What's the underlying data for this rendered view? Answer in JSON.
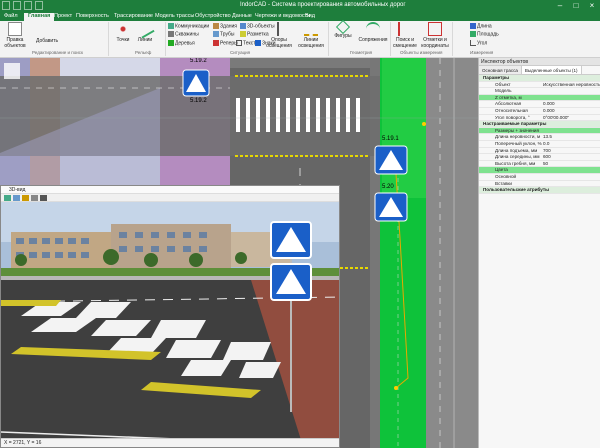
{
  "app": {
    "title": "IndorCAD - Система проектирования автомобильных дорог",
    "accent_color": "#1e7e3c",
    "window_controls": [
      "minimize-icon",
      "maximize-icon",
      "close-icon"
    ]
  },
  "menu": {
    "tabs": [
      "Файл",
      "Главная",
      "Проект",
      "Поверхность",
      "Трассирование",
      "Модель трассы",
      "Обустройство",
      "Данные",
      "Чертежи и ведомости",
      "Вид"
    ],
    "active": "Главная"
  },
  "ribbon": {
    "pravka_label": "Правка объектов",
    "add_label": "Добавить",
    "edit_group_label": "Редактирование и поиск",
    "tochki": "Точки",
    "linii": "Линии",
    "relief_group": "Рельеф",
    "communications": "Коммуникации",
    "skvazhiny": "Скважины",
    "derevya": "Деревья",
    "zdaniya": "Здания",
    "truby": "Трубы",
    "repery": "Реперы",
    "tekst": "Тексты",
    "d3_objects": "3D-объекты",
    "razmetka": "Разметка",
    "znaki": "Знаки",
    "situation_group": "Ситуация",
    "opory": "Опоры освещения",
    "linii_osv": "Линии освещения",
    "figury": "Фигуры",
    "sopryazheniya": "Сопряжения",
    "geometry_group": "Геометрия",
    "poisk": "Поиск и смещение",
    "otmetki": "Отметки и координаты",
    "dlina": "Длина",
    "ploshad": "Площадь",
    "ugol": "Угол",
    "measure_group": "Измерения",
    "objects_group": "Объекты измерения"
  },
  "plan": {
    "sign_labels": [
      "5.19.2",
      "5.19.1",
      "5.20",
      "5.19.2"
    ]
  },
  "inspector": {
    "title": "Инспектор объектов",
    "tabs": [
      "Основная трасса",
      "Выделенные объекты (1)"
    ],
    "rows": [
      {
        "type": "sec",
        "k": "Параметры",
        "v": ""
      },
      {
        "type": "row",
        "k": "Объект",
        "v": "Искусственная неровность"
      },
      {
        "type": "row",
        "k": "Модель",
        "v": ""
      },
      {
        "type": "hl",
        "k": "Z отметка, м",
        "v": ""
      },
      {
        "type": "row",
        "k": "Абсолютная",
        "v": "0.000"
      },
      {
        "type": "row",
        "k": "Относительная",
        "v": "0.000"
      },
      {
        "type": "row",
        "k": "Угол поворота, °",
        "v": "0°00'00.000\""
      },
      {
        "type": "sec",
        "k": "Настраиваемые параметры",
        "v": ""
      },
      {
        "type": "hl",
        "k": "Размеры + значения",
        "v": ""
      },
      {
        "type": "row",
        "k": "Длина неровности, м",
        "v": "13.5"
      },
      {
        "type": "row",
        "k": "Поперечный уклон, %",
        "v": "0.0"
      },
      {
        "type": "row",
        "k": "Длина подъема, мм",
        "v": "700"
      },
      {
        "type": "row",
        "k": "Длина середины, мм",
        "v": "600"
      },
      {
        "type": "row",
        "k": "Высота гребня, мм",
        "v": "50"
      },
      {
        "type": "hl",
        "k": "Цвета",
        "v": ""
      },
      {
        "type": "row",
        "k": "Основной",
        "v": ""
      },
      {
        "type": "row",
        "k": "Вставки",
        "v": ""
      },
      {
        "type": "sec",
        "k": "Пользовательские атрибуты",
        "v": ""
      }
    ]
  },
  "view3d": {
    "title": "3D-вид",
    "status": "X = 2721, Y = 16"
  }
}
